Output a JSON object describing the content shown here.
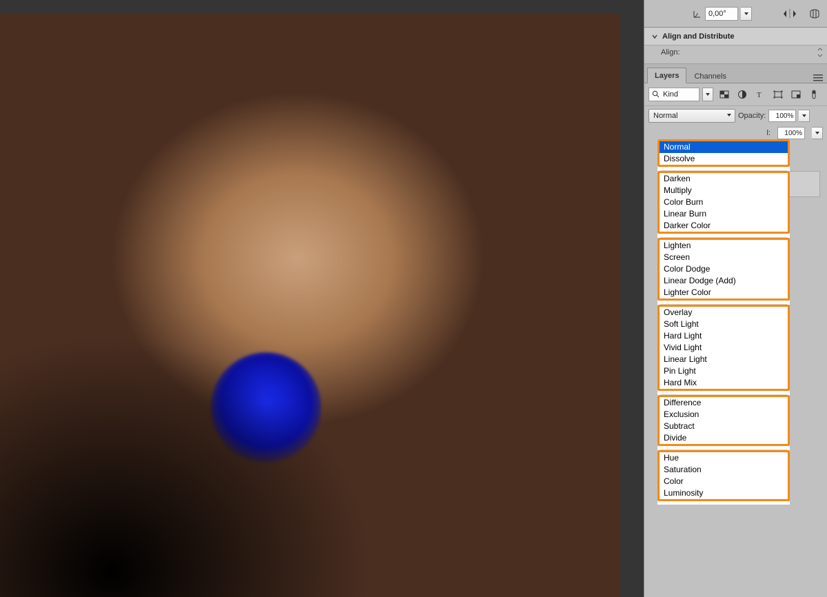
{
  "options_bar": {
    "angle_value": "0,00°"
  },
  "align_panel": {
    "title": "Align and Distribute",
    "sub_label": "Align:"
  },
  "layers_panel": {
    "tabs": [
      "Layers",
      "Channels"
    ],
    "active_tab": 0,
    "kind_label": "Kind",
    "blend_mode_selected": "Normal",
    "opacity_label": "Opacity:",
    "opacity_value": "100%",
    "fill_label_suffix": "l:",
    "fill_value": "100%"
  },
  "blend_modes": {
    "selected": "Normal",
    "groups": [
      [
        "Normal",
        "Dissolve"
      ],
      [
        "Darken",
        "Multiply",
        "Color Burn",
        "Linear Burn",
        "Darker Color"
      ],
      [
        "Lighten",
        "Screen",
        "Color Dodge",
        "Linear Dodge (Add)",
        "Lighter Color"
      ],
      [
        "Overlay",
        "Soft Light",
        "Hard Light",
        "Vivid Light",
        "Linear Light",
        "Pin Light",
        "Hard Mix"
      ],
      [
        "Difference",
        "Exclusion",
        "Subtract",
        "Divide"
      ],
      [
        "Hue",
        "Saturation",
        "Color",
        "Luminosity"
      ]
    ]
  },
  "icons": {
    "angle": "angle-icon",
    "flip_h": "flip-horizontal-icon",
    "warp_reset": "warp-reset-icon",
    "chevron_down": "chevron-down-icon",
    "search": "search-icon",
    "filter_pixel": "pixel-layer-icon",
    "filter_adjust": "adjustment-layer-icon",
    "filter_type": "type-layer-icon",
    "filter_shape": "shape-layer-icon",
    "filter_smart": "smart-object-icon",
    "filter_toggle": "filter-toggle-icon",
    "panel_menu": "panel-menu-icon"
  }
}
